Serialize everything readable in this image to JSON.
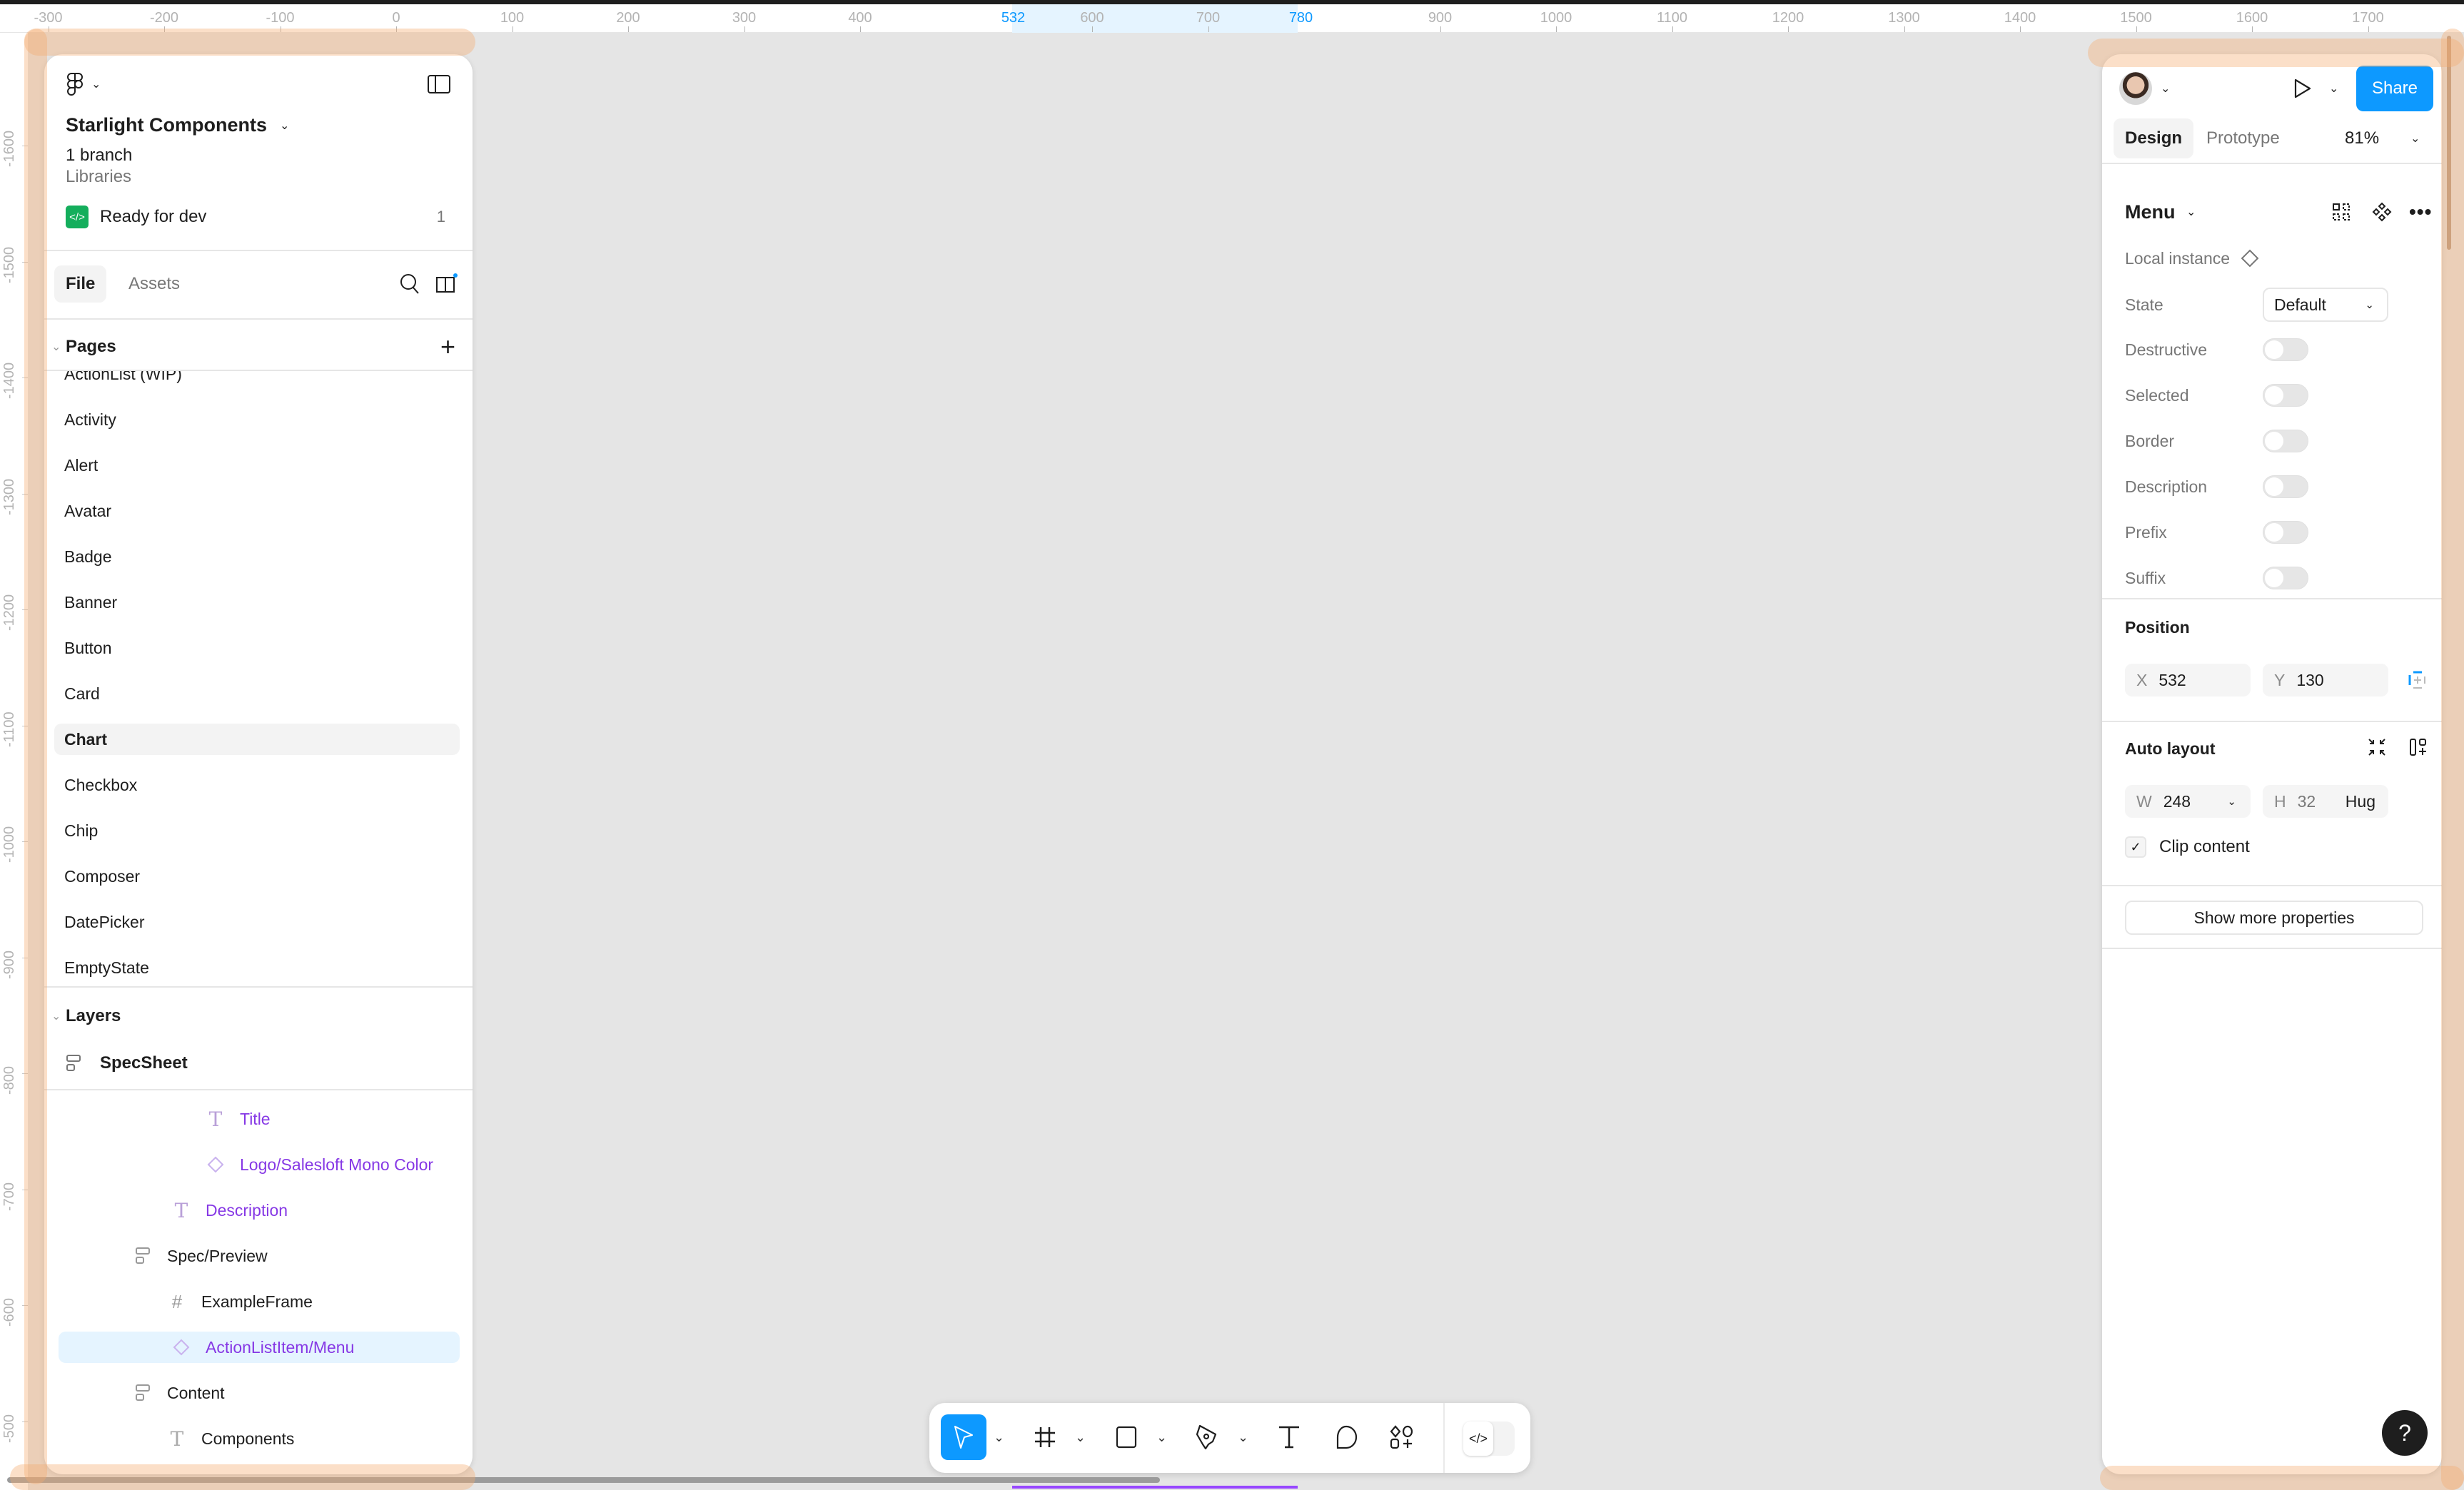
{
  "rulers": {
    "horizontal_ticks": [
      "-300",
      "-200",
      "-100",
      "0",
      "100",
      "200",
      "300",
      "400",
      "532",
      "600",
      "700",
      "780",
      "900",
      "1000",
      "1100",
      "1200",
      "1300",
      "1400",
      "1500",
      "1600",
      "1700"
    ],
    "horizontal_selected": [
      "532",
      "780"
    ],
    "vertical_ticks": [
      "-1600",
      "-1500",
      "-1400",
      "-1300",
      "-1200",
      "-1100",
      "-1000",
      "-900",
      "-800",
      "-700",
      "-600",
      "-500"
    ]
  },
  "left_panel": {
    "file_name": "Starlight Components",
    "branch": "1 branch",
    "library": "Libraries",
    "ready_for_dev": {
      "label": "Ready for dev",
      "count": "1",
      "color": "#14ae5c"
    },
    "tabs": [
      {
        "label": "File",
        "active": true
      },
      {
        "label": "Assets",
        "active": false
      }
    ],
    "pages_header": "Pages",
    "pages": [
      {
        "label": "ActionList (WIP)",
        "active": false
      },
      {
        "label": "Activity",
        "active": false
      },
      {
        "label": "Alert",
        "active": false
      },
      {
        "label": "Avatar",
        "active": false
      },
      {
        "label": "Badge",
        "active": false
      },
      {
        "label": "Banner",
        "active": false
      },
      {
        "label": "Button",
        "active": false
      },
      {
        "label": "Card",
        "active": false
      },
      {
        "label": "Chart",
        "active": true
      },
      {
        "label": "Checkbox",
        "active": false
      },
      {
        "label": "Chip",
        "active": false
      },
      {
        "label": "Composer",
        "active": false
      },
      {
        "label": "DatePicker",
        "active": false
      },
      {
        "label": "EmptyState",
        "active": false
      }
    ],
    "layers_header": "Layers",
    "pinned_layer": {
      "label": "SpecSheet",
      "icon": "auto-layout-icon"
    },
    "layers": [
      {
        "label": "Title",
        "icon": "text-icon",
        "kind": "instance-child"
      },
      {
        "label": "Logo/Salesloft Mono Color",
        "icon": "instance-icon",
        "kind": "instance-child"
      },
      {
        "label": "Description",
        "icon": "text-icon",
        "kind": "instance-child"
      },
      {
        "label": "Spec/Preview",
        "icon": "auto-layout-icon",
        "kind": "normal"
      },
      {
        "label": "ExampleFrame",
        "icon": "frame-icon",
        "kind": "normal"
      },
      {
        "label": "ActionListItem/Menu",
        "icon": "instance-icon",
        "kind": "instance",
        "selected": true
      },
      {
        "label": "Content",
        "icon": "auto-layout-icon",
        "kind": "normal"
      },
      {
        "label": "Components",
        "icon": "text-icon",
        "kind": "normal"
      }
    ]
  },
  "right_panel": {
    "share_label": "Share",
    "tabs": [
      {
        "label": "Design",
        "active": true
      },
      {
        "label": "Prototype",
        "active": false
      }
    ],
    "zoom": "81%",
    "component_name": "Menu",
    "local_instance_label": "Local instance",
    "state": {
      "label": "State",
      "value": "Default"
    },
    "toggles": [
      {
        "label": "Destructive",
        "on": false
      },
      {
        "label": "Selected",
        "on": false
      },
      {
        "label": "Border",
        "on": false
      },
      {
        "label": "Description",
        "on": false
      },
      {
        "label": "Prefix",
        "on": false
      },
      {
        "label": "Suffix",
        "on": false
      }
    ],
    "position": {
      "title": "Position",
      "x_label": "X",
      "x": "532",
      "y_label": "Y",
      "y": "130"
    },
    "auto_layout": {
      "title": "Auto layout",
      "w_label": "W",
      "w": "248",
      "h_label": "H",
      "h": "32",
      "h_mode": "Hug",
      "clip_content_label": "Clip content",
      "clip_content": true
    },
    "show_more_label": "Show more properties"
  },
  "toolbar": {
    "tools": [
      "move-tool",
      "frame-tool",
      "shape-tool",
      "pen-tool",
      "text-tool",
      "comment-tool",
      "actions-tool"
    ],
    "active_tool": "move-tool",
    "dev_mode_label": "</>"
  },
  "help_label": "?",
  "colors": {
    "accent": "#0d99ff",
    "component_purple": "#8638e5",
    "canvas": "#e5e5e5"
  }
}
